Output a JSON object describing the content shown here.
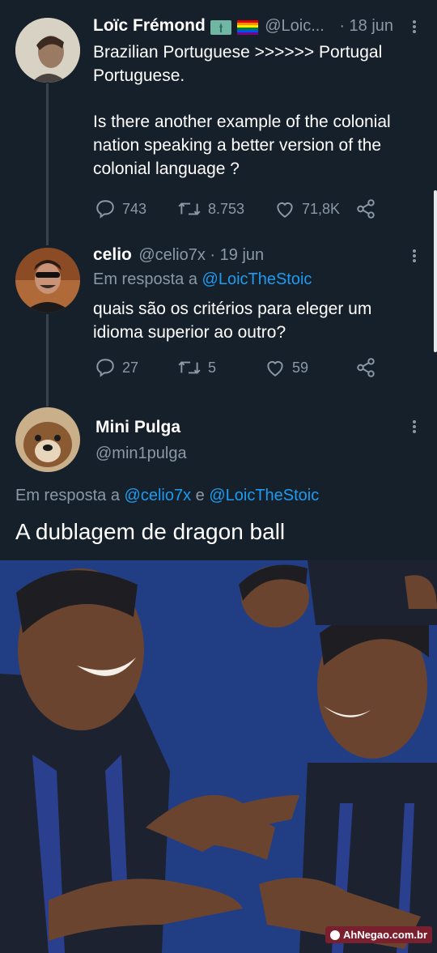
{
  "tweets": [
    {
      "name": "Loïc Frémond",
      "handle": "@Loic...",
      "date": "· 18 jun",
      "text_lines": [
        "Brazilian Portuguese >>>>>> Portugal",
        "Portuguese."
      ],
      "text_lines_2": [
        "Is there another example of the colonial",
        "nation speaking a better version of the",
        "colonial language ?"
      ],
      "replies": "743",
      "retweets": "8.753",
      "likes": "71,8K"
    },
    {
      "name": "celio",
      "handle": "@celio7x · 19 jun",
      "reply_prefix": "Em resposta a",
      "reply_to": "@LoicTheStoic",
      "text_lines": [
        "quais são os critérios para eleger um",
        "idioma superior ao outro?"
      ],
      "replies": "27",
      "retweets": "5",
      "likes": "59"
    },
    {
      "name": "Mini Pulga",
      "handle": "@min1pulga",
      "reply_prefix": "Em resposta a",
      "reply_to_1": "@celio7x",
      "reply_join": "e",
      "reply_to_2": "@LoicTheStoic",
      "text": "A dublagem de dragon ball"
    }
  ],
  "watermark": "AhNegao.com.br",
  "colors": {
    "background": "#15202b",
    "link": "#1d9bf0",
    "muted": "#8b98a5",
    "meme_bg": "#1f3f87"
  },
  "icons": [
    "reply-icon",
    "retweet-icon",
    "like-icon",
    "share-icon",
    "more-icon",
    "flag-icons"
  ]
}
